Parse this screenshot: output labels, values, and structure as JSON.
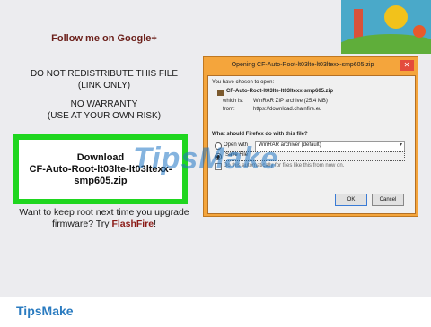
{
  "left": {
    "follow": "Follow me on Google+",
    "warn1": [
      "DO NOT REDISTRIBUTE THIS FILE",
      "(LINK ONLY)"
    ],
    "warn2": [
      "NO WARRANTY",
      "(USE AT YOUR OWN RISK)"
    ],
    "download_title": "Download",
    "download_file": "CF-Auto-Root-lt03lte-lt03ltexx-smp605.zip",
    "root_prefix": "Want to keep root next time you upgrade firmware? Try ",
    "root_link": "FlashFire",
    "root_suffix": "!"
  },
  "dialog": {
    "title": "Opening CF-Auto-Root-lt03lte-lt03ltexx-smp605.zip",
    "close": "✕",
    "chosen_label": "You have chosen to open:",
    "file_name": "CF-Auto-Root-lt03lte-lt03ltexx-smp605.zip",
    "which_label": "which is:",
    "which_value": "WinRAR ZIP archive (25.4 MB)",
    "from_label": "from:",
    "from_value": "https://download.chainfire.eu",
    "question": "What should Firefox do with this file?",
    "open_with_label": "Open with",
    "open_with_value": "WinRAR archiver (default)",
    "save_file": "Save File",
    "auto_text": "Do this automatically for files like this from now on.",
    "ok": "OK",
    "cancel": "Cancel"
  },
  "watermark": "TipsMake",
  "brand": "TipsMake",
  "colors": {
    "green_box": "#1fd61f",
    "dialog_frame": "#f4a53c",
    "brand": "#2a7bc0",
    "link": "#8b1a16"
  }
}
